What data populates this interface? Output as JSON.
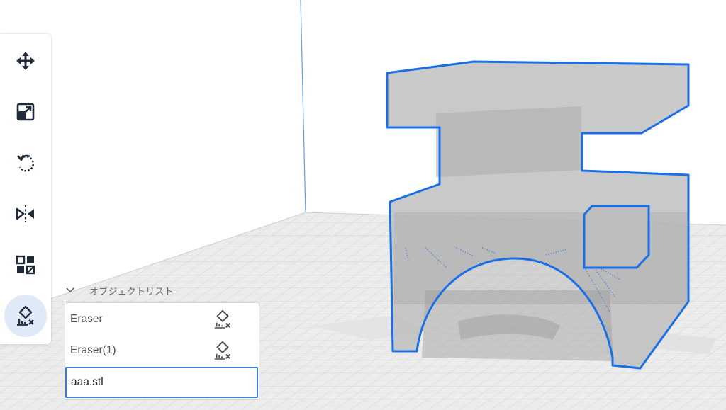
{
  "toolbar": {
    "tools": [
      {
        "name": "move",
        "icon": "move-icon",
        "active": false
      },
      {
        "name": "scale",
        "icon": "scale-icon",
        "active": false
      },
      {
        "name": "rotate",
        "icon": "rotate-icon",
        "active": false
      },
      {
        "name": "mirror",
        "icon": "mirror-icon",
        "active": false
      },
      {
        "name": "per-model-settings",
        "icon": "per-model-settings-icon",
        "active": false
      },
      {
        "name": "support-blocker",
        "icon": "support-blocker-icon",
        "active": true
      }
    ]
  },
  "object_list": {
    "title": "オブジェクトリスト",
    "items": [
      {
        "label": "Eraser",
        "icon": "support-blocker-icon",
        "selected": false
      },
      {
        "label": "Eraser(1)",
        "icon": "support-blocker-icon",
        "selected": false
      },
      {
        "label": "aaa.stl",
        "icon": "",
        "selected": true
      }
    ]
  },
  "colors": {
    "accent": "#1a6fe6",
    "selection_outline": "#1a6fe6",
    "build_plate": "#ececec",
    "model_fill": "#b9b9b9",
    "icon": "#1e2a3a"
  }
}
